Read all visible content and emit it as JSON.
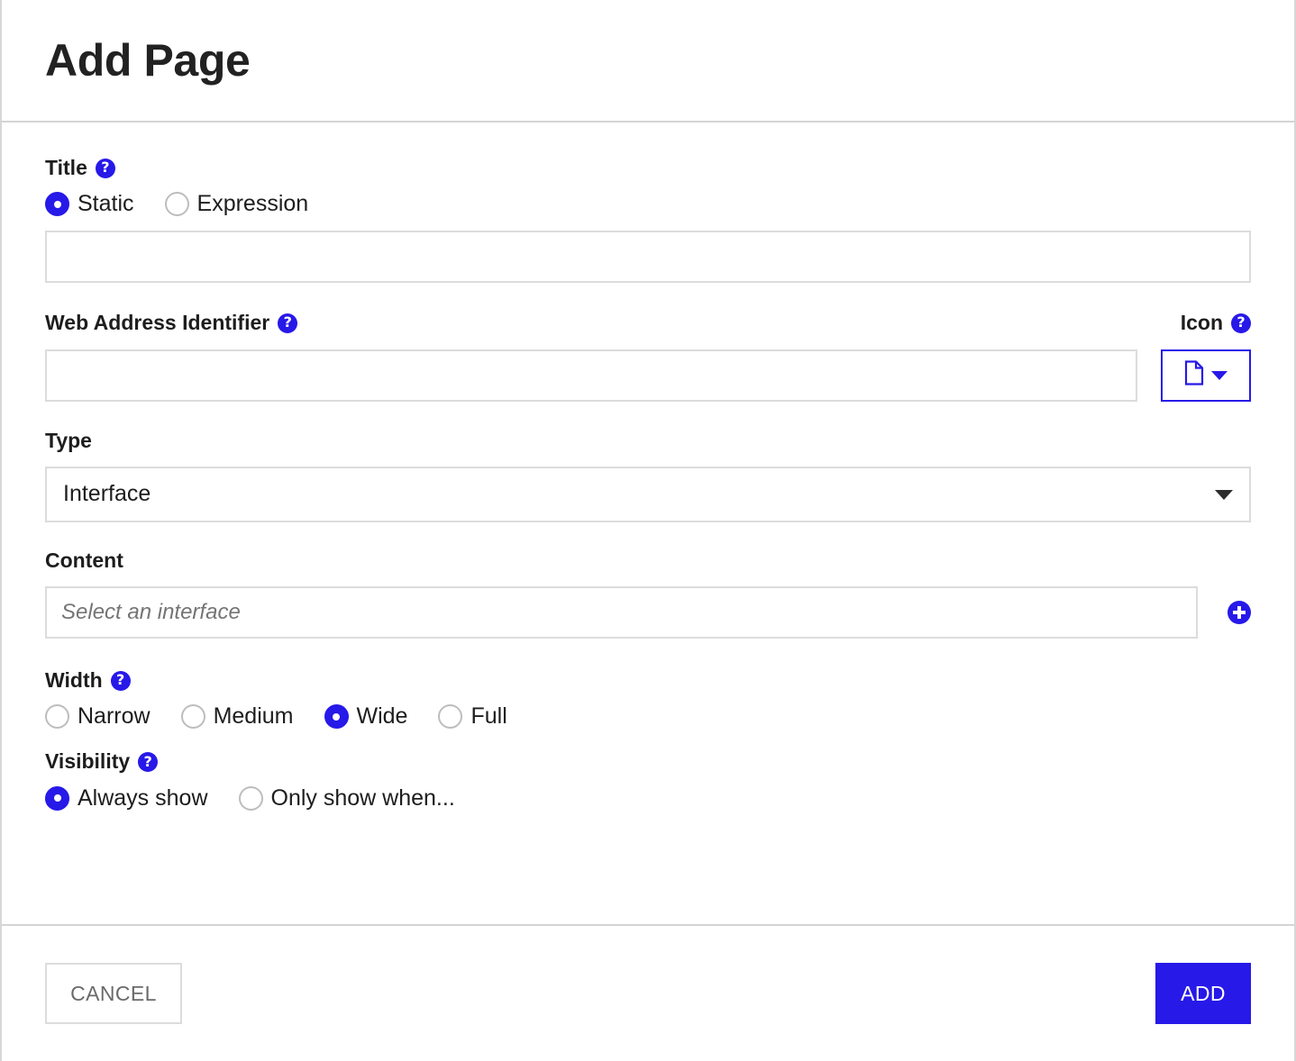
{
  "header": {
    "title": "Add Page"
  },
  "help_icon_glyph": "?",
  "colors": {
    "accent_blue": "#2719e8",
    "border_gray": "#dcdcdc",
    "divider_gray": "#d4d4d4",
    "text_dark": "#1d1d1d",
    "placeholder_gray": "#757575",
    "cancel_text_gray": "#6a6a6a"
  },
  "fields": {
    "title": {
      "label": "Title",
      "has_help": true,
      "options": [
        {
          "label": "Static",
          "selected": true
        },
        {
          "label": "Expression",
          "selected": false
        }
      ],
      "input_value": "",
      "input_placeholder": ""
    },
    "web_address_identifier": {
      "label": "Web Address Identifier",
      "has_help": true,
      "input_value": "",
      "input_placeholder": ""
    },
    "icon": {
      "label": "Icon",
      "has_help": true,
      "selected_icon": "document-file-icon",
      "caret": "chevron-down-icon"
    },
    "type": {
      "label": "Type",
      "has_help": false,
      "selected_value": "Interface"
    },
    "content": {
      "label": "Content",
      "has_help": false,
      "input_value": "",
      "input_placeholder": "Select an interface",
      "add_button": "add-circle-icon"
    },
    "width": {
      "label": "Width",
      "has_help": true,
      "options": [
        {
          "label": "Narrow",
          "selected": false
        },
        {
          "label": "Medium",
          "selected": false
        },
        {
          "label": "Wide",
          "selected": true
        },
        {
          "label": "Full",
          "selected": false
        }
      ]
    },
    "visibility": {
      "label": "Visibility",
      "has_help": true,
      "options": [
        {
          "label": "Always show",
          "selected": true
        },
        {
          "label": "Only show when...",
          "selected": false
        }
      ]
    }
  },
  "footer": {
    "cancel_label": "CANCEL",
    "add_label": "ADD"
  }
}
